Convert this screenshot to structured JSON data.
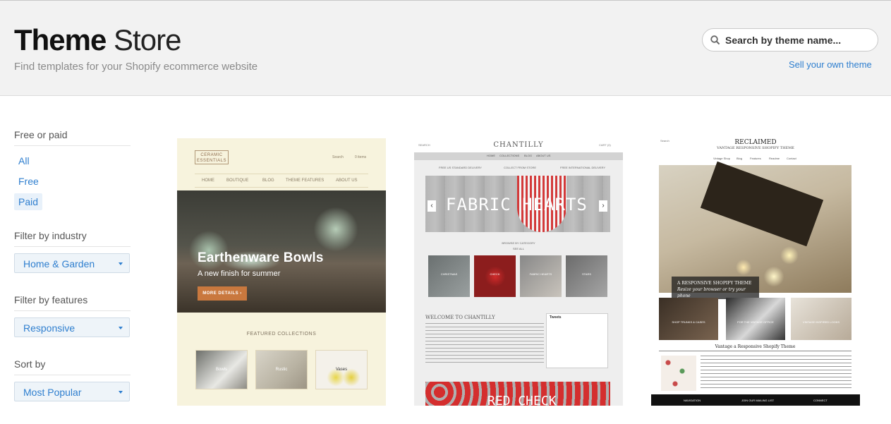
{
  "header": {
    "title_bold": "Theme",
    "title_light": "Store",
    "subtitle": "Find templates for your Shopify ecommerce website",
    "search_placeholder": "Search by theme name...",
    "sell_link": "Sell your own theme"
  },
  "sidebar": {
    "price": {
      "title": "Free or paid",
      "options": [
        "All",
        "Free",
        "Paid"
      ],
      "selected": "Paid"
    },
    "industry": {
      "title": "Filter by industry",
      "value": "Home & Garden"
    },
    "features": {
      "title": "Filter by features",
      "value": "Responsive"
    },
    "sort": {
      "title": "Sort by",
      "value": "Most Popular"
    }
  },
  "themes": [
    {
      "logo": "CERAMIC ESSENTIALS",
      "nav": [
        "HOME",
        "BOUTIQUE",
        "BLOG",
        "THEME FEATURES",
        "ABOUT US"
      ],
      "search": "Search",
      "cart": "0 items",
      "hero_title": "Earthenware Bowls",
      "hero_sub": "A new finish for summer",
      "hero_button": "MORE DETAILS ›",
      "featured_title": "FEATURED COLLECTIONS",
      "collections": [
        "Bowls",
        "Rustic",
        "Vases"
      ]
    },
    {
      "brand": "CHANTILLY",
      "search": "SEARCH",
      "cart": "CART (0)",
      "menu": [
        "HOME",
        "COLLECTIONS",
        "BLOG",
        "ABOUT US"
      ],
      "promos": [
        "FREE US STANDARD DELIVERY",
        "COLLECT FROM STORE",
        "FREE INTERNATIONAL DELIVERY"
      ],
      "slide_title": "FABRIC HEARTS",
      "browse": "BROWSE BY CATEGORY",
      "see_all": "SEE ALL",
      "categories": [
        "CHRISTMAS",
        "CHECK",
        "FABRIC HEARTS",
        "STARS"
      ],
      "welcome": "WELCOME TO CHANTILLY",
      "tweets_title": "Tweets",
      "bottom_title": "RED CHECK"
    },
    {
      "search": "Search",
      "brand": "RECLAIMED",
      "tagline": "VANTAGE RESPONSIVE SHOPIFY THEME",
      "nav": [
        "Vintage Shop",
        "Blog",
        "Features",
        "Readme",
        "Contact"
      ],
      "caption_title": "A RESPONSIVE SHOPIFY THEME",
      "caption_sub": "Resize your browser or try your phone",
      "tiles": [
        "SHOP TRUNKS & CASES",
        "FOR THE VINTAGE OFFICE",
        "VINTAGE INSPIRED LOOKS"
      ],
      "section_title": "Vantage a Responsive Shopify Theme",
      "footer": [
        "NAVIGATION",
        "JOIN OUR MAILING LIST",
        "CONNECT"
      ]
    }
  ],
  "colors": {
    "accent": "#2f7fcf",
    "header_bg": "#f2f2f2",
    "selected_bg": "#e8f1fa",
    "button": "#c9783e"
  },
  "icons": [
    "search-icon",
    "caret-down-icon"
  ]
}
